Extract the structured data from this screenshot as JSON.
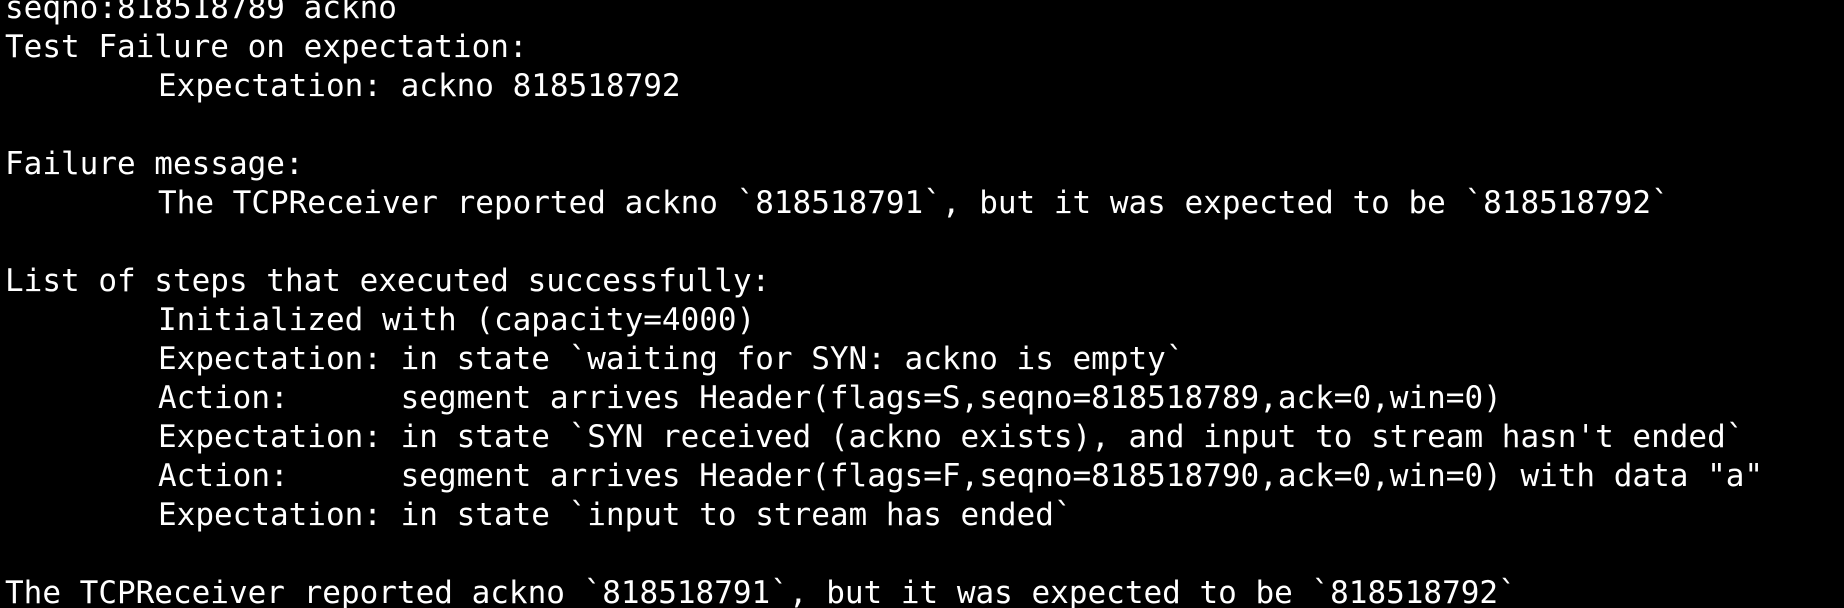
{
  "terminal": {
    "lines": {
      "l0": "seqno:818518789 ackno",
      "l1": "Test Failure on expectation:",
      "l2": "Expectation: ackno 818518792",
      "l3": "Failure message:",
      "l4": "The TCPReceiver reported ackno `818518791`, but it was expected to be `818518792`",
      "l5": "List of steps that executed successfully:",
      "l6": "Initialized with (capacity=4000)",
      "l7": "Expectation: in state `waiting for SYN: ackno is empty`",
      "l8": "Action:      segment arrives Header(flags=S,seqno=818518789,ack=0,win=0)",
      "l9": "Expectation: in state `SYN received (ackno exists), and input to stream hasn't ended`",
      "l10": "Action:      segment arrives Header(flags=F,seqno=818518790,ack=0,win=0) with data \"a\"",
      "l11": "Expectation: in state `input to stream has ended`",
      "l12": "The TCPReceiver reported ackno `818518791`, but it was expected to be `818518792`"
    },
    "colors": {
      "background": "#000000",
      "foreground": "#ffffff"
    }
  }
}
